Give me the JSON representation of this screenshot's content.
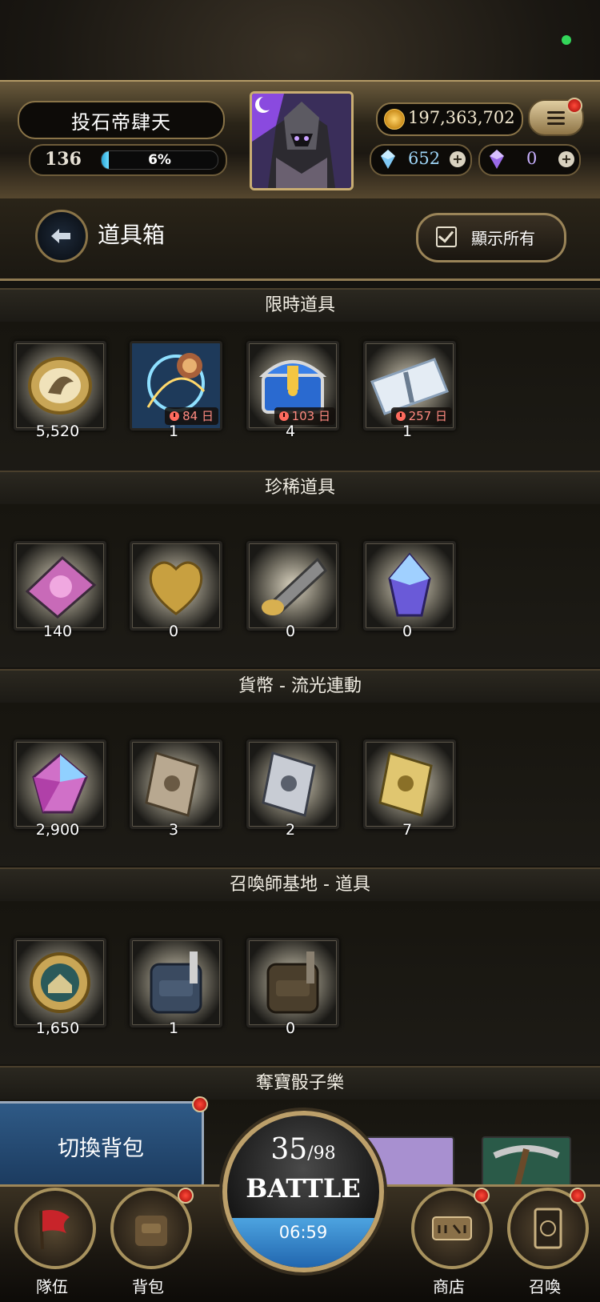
{
  "player": {
    "name": "投石帝肆天",
    "level": "136",
    "exp_percent": "6%",
    "exp_fraction": 0.06
  },
  "currency": {
    "gold": "197,363,702",
    "blue_crystal": "652",
    "purple_crystal": "0"
  },
  "inventory": {
    "title": "道具箱",
    "show_all_label": "顯示所有"
  },
  "sections": [
    {
      "title": "限時道具",
      "items": [
        {
          "name": "gold-coin-token",
          "count": "5,520",
          "timer": ""
        },
        {
          "name": "lion-summon-orb",
          "count": "1",
          "timer": "84 日"
        },
        {
          "name": "blue-treasure-chest",
          "count": "4",
          "timer": "103 日"
        },
        {
          "name": "silver-ticket",
          "count": "1",
          "timer": "257 日"
        }
      ]
    },
    {
      "title": "珍稀道具",
      "items": [
        {
          "name": "pink-skill-card",
          "count": "140"
        },
        {
          "name": "golden-heart",
          "count": "0"
        },
        {
          "name": "golden-horn",
          "count": "0"
        },
        {
          "name": "prism-crystal",
          "count": "0"
        }
      ]
    },
    {
      "title": "貨幣 - 流光連動",
      "items": [
        {
          "name": "rainbow-gem",
          "count": "2,900"
        },
        {
          "name": "bronze-card",
          "count": "3"
        },
        {
          "name": "silver-card",
          "count": "2"
        },
        {
          "name": "gold-card",
          "count": "7"
        }
      ]
    },
    {
      "title": "召喚師基地 - 道具",
      "items": [
        {
          "name": "base-coin",
          "count": "1,650"
        },
        {
          "name": "blue-backpack",
          "count": "1"
        },
        {
          "name": "brown-backpack",
          "count": "0"
        }
      ]
    },
    {
      "title": "奪寶骰子樂",
      "items": []
    }
  ],
  "bottom": {
    "switch_bag": "切換背包",
    "stamina_current": "35",
    "stamina_max": "/98",
    "battle": "BATTLE",
    "timer": "06:59",
    "nav": {
      "team": "隊伍",
      "bag": "背包",
      "shop": "商店",
      "summon": "召喚"
    }
  }
}
